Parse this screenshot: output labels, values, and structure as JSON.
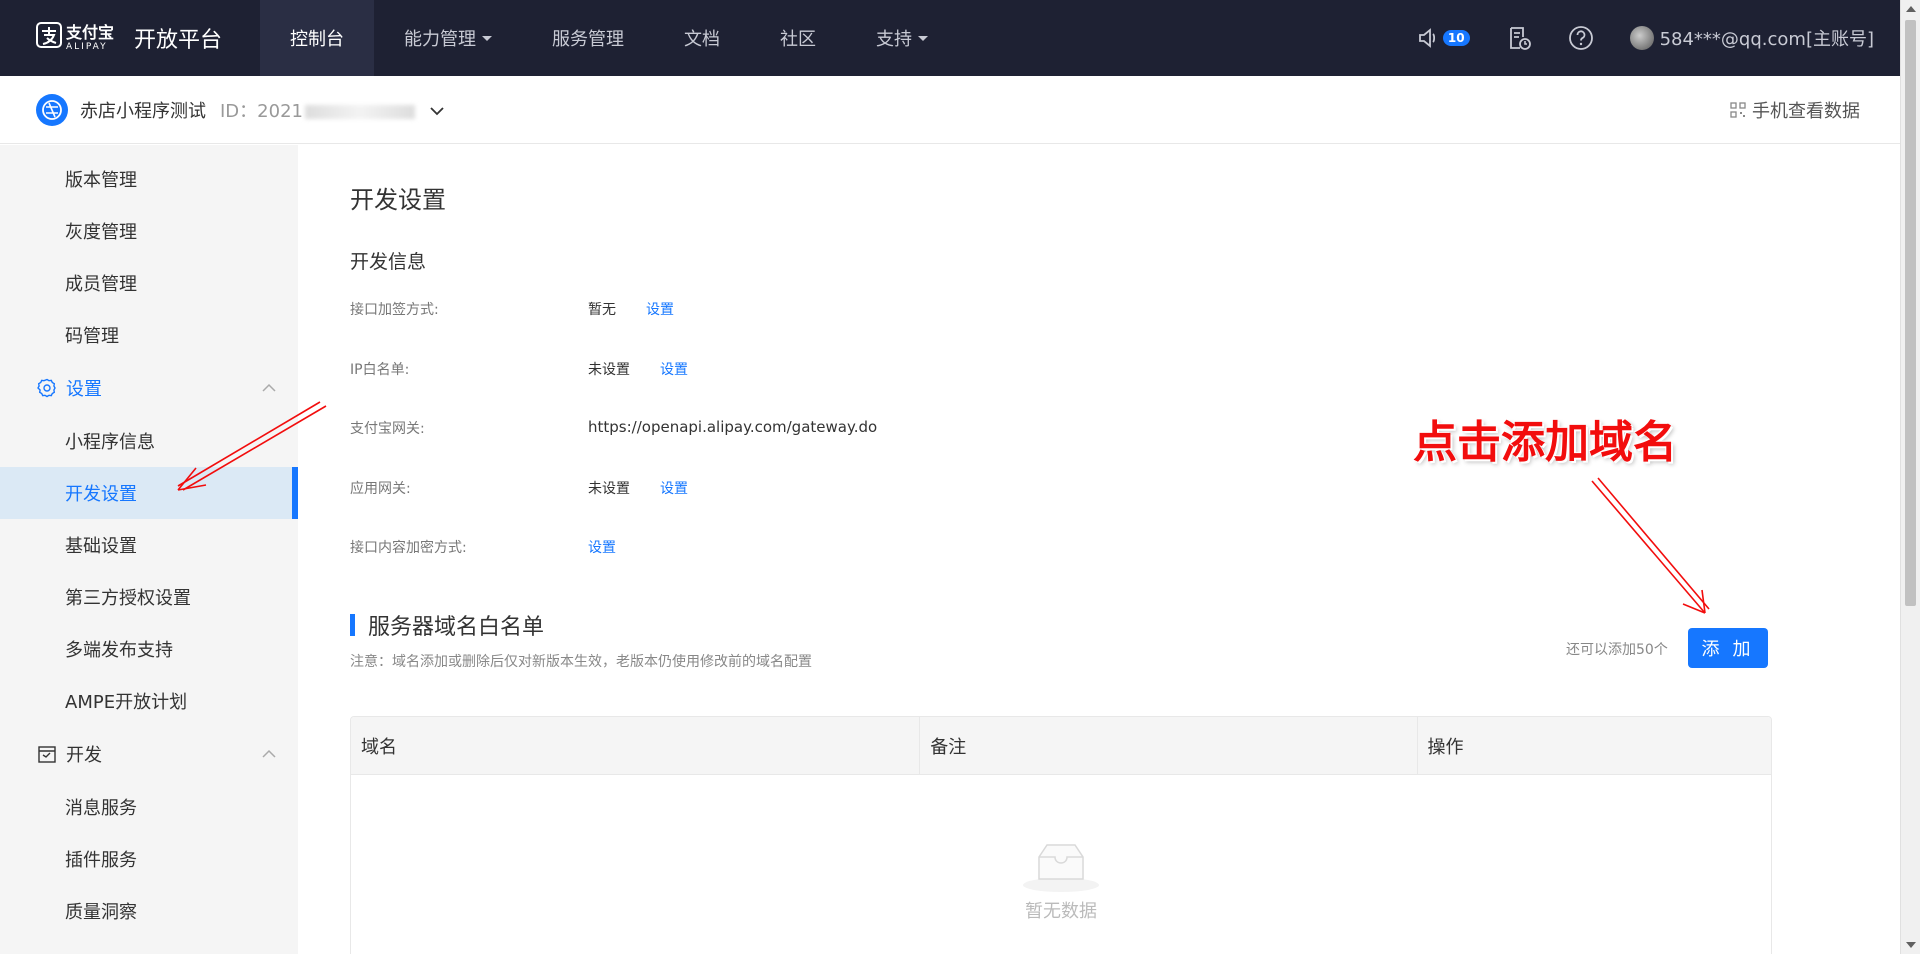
{
  "topnav": {
    "logo_text_cn": "支付宝",
    "logo_text_en": "ALIPAY",
    "platform_name": "开放平台",
    "items": [
      {
        "label": "控制台",
        "active": true,
        "dropdown": false
      },
      {
        "label": "能力管理",
        "active": false,
        "dropdown": true
      },
      {
        "label": "服务管理",
        "active": false,
        "dropdown": false
      },
      {
        "label": "文档",
        "active": false,
        "dropdown": false
      },
      {
        "label": "社区",
        "active": false,
        "dropdown": false
      },
      {
        "label": "支持",
        "active": false,
        "dropdown": true
      }
    ],
    "notification_count": "10",
    "user": "584***@qq.com[主账号]"
  },
  "subheader": {
    "app_name": "赤店小程序测试",
    "app_id_prefix": "ID：2021",
    "mobile_data": "手机查看数据"
  },
  "sidebar": {
    "items_top": [
      "版本管理",
      "灰度管理",
      "成员管理",
      "码管理"
    ],
    "group_settings": "设置",
    "items_settings": [
      "小程序信息",
      "开发设置",
      "基础设置",
      "第三方授权设置",
      "多端发布支持",
      "AMPE开放计划"
    ],
    "active_item": "开发设置",
    "group_dev": "开发",
    "items_dev": [
      "消息服务",
      "插件服务",
      "质量洞察"
    ]
  },
  "main": {
    "page_title": "开发设置",
    "section_title": "开发信息",
    "info_rows": [
      {
        "label": "接口加签方式:",
        "value": "暂无",
        "link": "设置"
      },
      {
        "label": "IP白名单:",
        "value": "未设置",
        "link": "设置"
      },
      {
        "label": "支付宝网关:",
        "value": "https://openapi.alipay.com/gateway.do",
        "link": ""
      },
      {
        "label": "应用网关:",
        "value": "未设置",
        "link": "设置"
      },
      {
        "label": "接口内容加密方式:",
        "value": "",
        "link": "设置"
      }
    ],
    "whitelist_title": "服务器域名白名单",
    "whitelist_note": "注意：域名添加或删除后仅对新版本生效，老版本仍使用修改前的域名配置",
    "remaining_text": "还可以添加50个",
    "add_button": "添 加",
    "table_headers": [
      "域名",
      "备注",
      "操作"
    ],
    "empty_text": "暂无数据"
  },
  "annotation": {
    "text": "点击添加域名",
    "color": "#f20d0d"
  },
  "colors": {
    "nav_bg": "#1e2133",
    "primary": "#1677ff",
    "sidebar_bg": "#f5f5f5",
    "active_bg": "#dbe9f5"
  }
}
